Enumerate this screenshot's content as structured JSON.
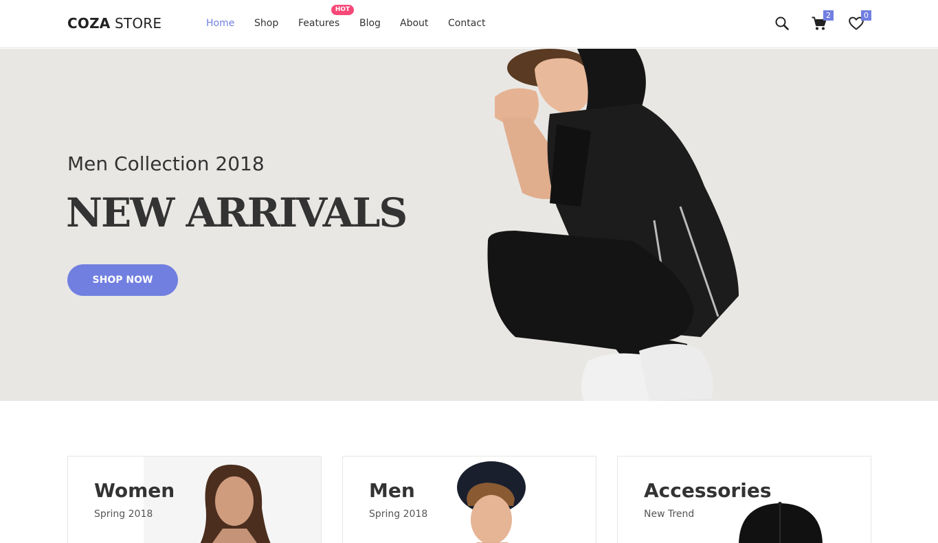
{
  "header": {
    "logo_bold": "COZA",
    "logo_light": " STORE",
    "nav": [
      {
        "label": "Home",
        "active": true
      },
      {
        "label": "Shop",
        "active": false
      },
      {
        "label": "Features",
        "active": false
      },
      {
        "label": "Blog",
        "active": false
      },
      {
        "label": "About",
        "active": false
      },
      {
        "label": "Contact",
        "active": false
      }
    ],
    "hot_label": "HOT",
    "cart_count": "2",
    "wishlist_count": "0"
  },
  "hero": {
    "subtitle": "Men Collection 2018",
    "title": "NEW ARRIVALS",
    "button": "SHOP NOW"
  },
  "banners": [
    {
      "title": "Women",
      "subtitle": "Spring 2018"
    },
    {
      "title": "Men",
      "subtitle": "Spring 2018"
    },
    {
      "title": "Accessories",
      "subtitle": "New Trend"
    }
  ],
  "icons": {
    "search": "search-icon",
    "cart": "cart-icon",
    "wishlist": "heart-icon"
  },
  "colors": {
    "accent": "#717fe0",
    "hot": "#f74877",
    "hero_bg": "#e9e7e4",
    "text": "#333333"
  }
}
